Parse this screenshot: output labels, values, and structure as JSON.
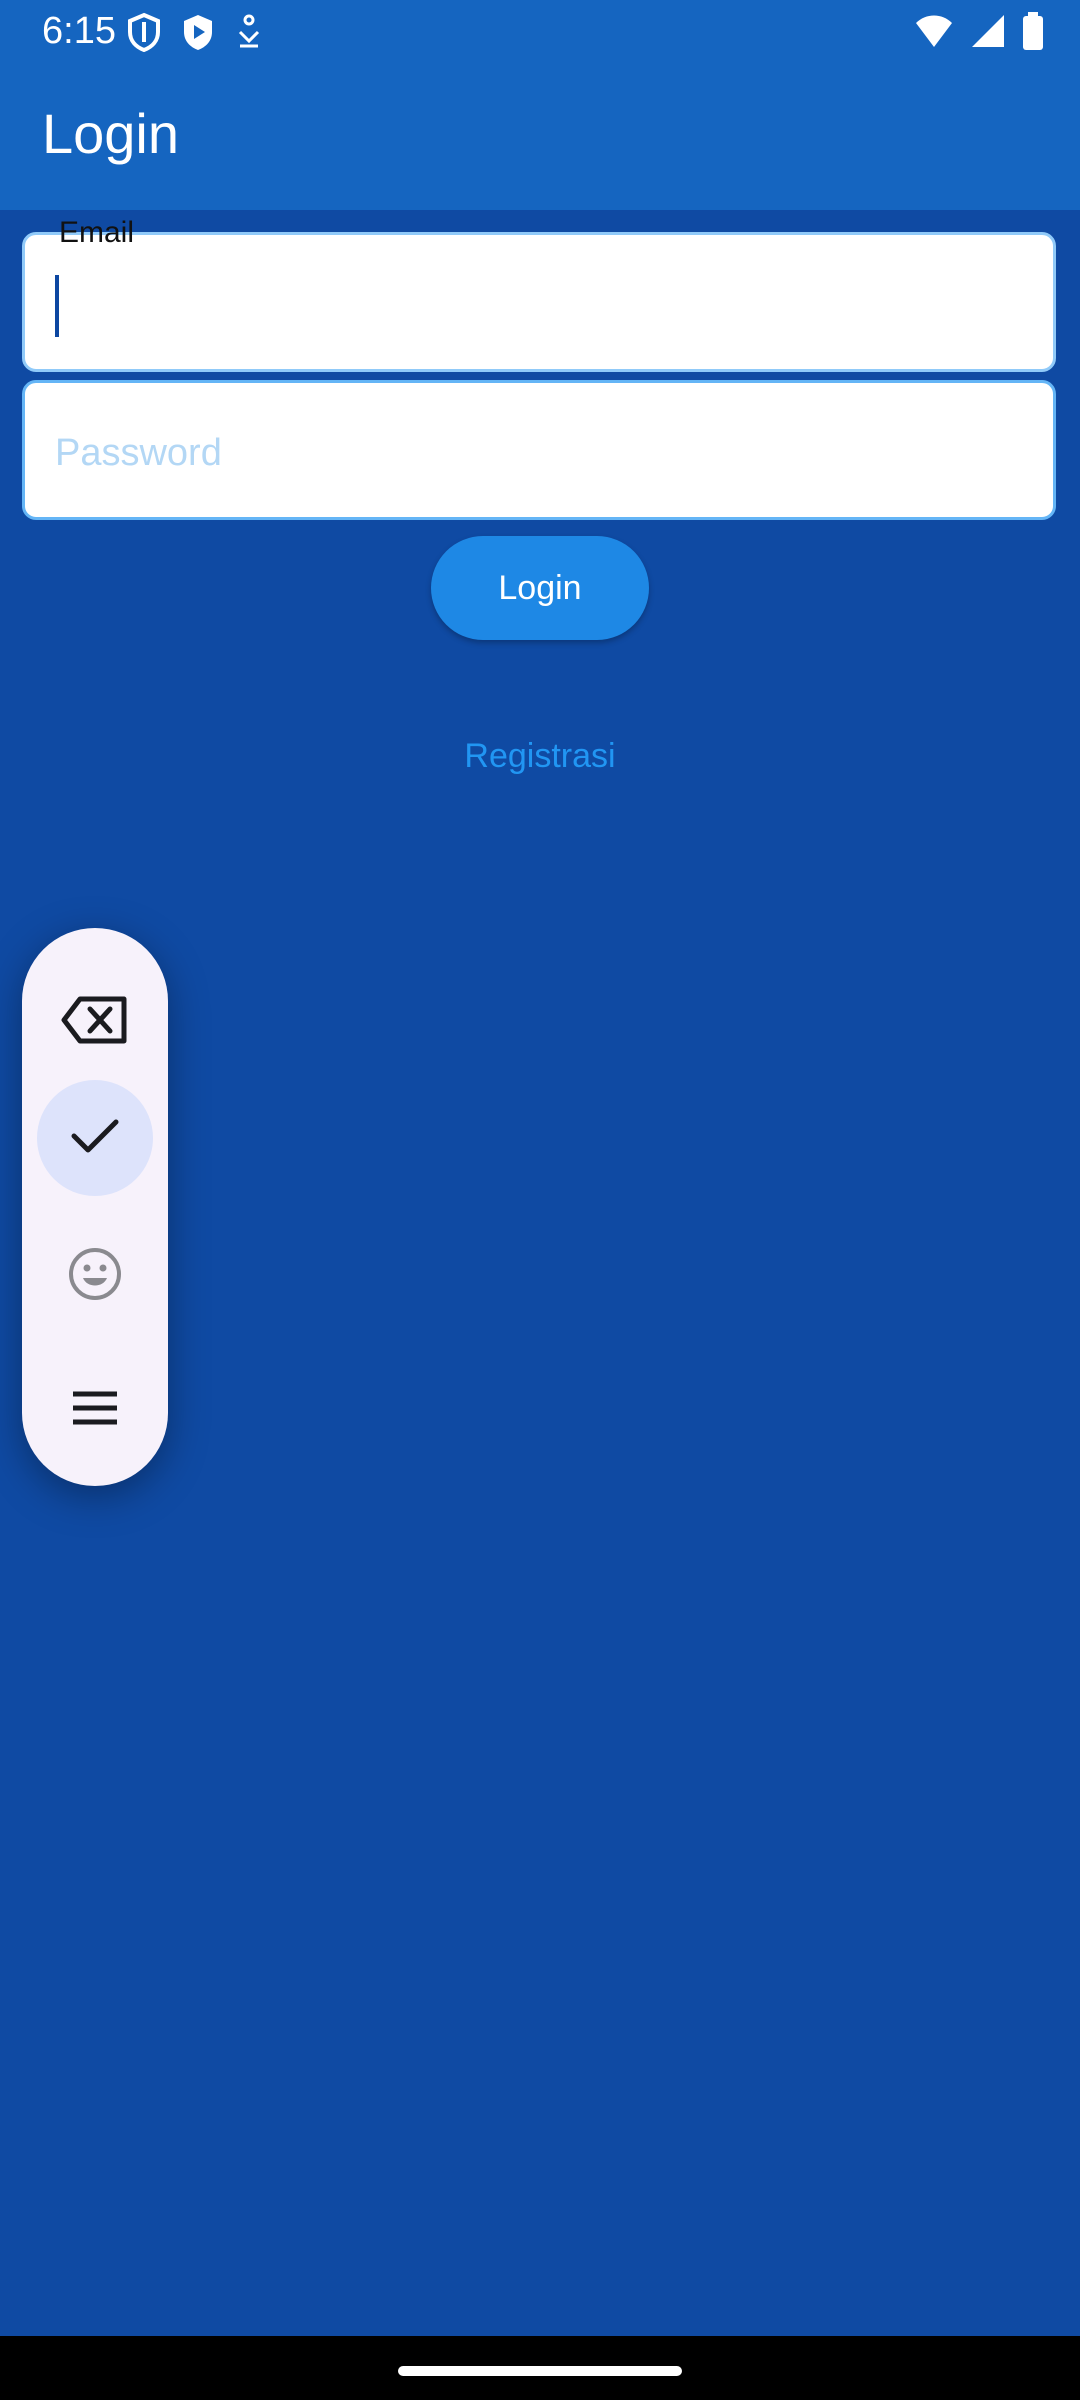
{
  "status_bar": {
    "time": "6:15",
    "left_icons": [
      "shield-icon",
      "play-shield-icon",
      "download-icon"
    ],
    "right_icons": [
      "wifi-icon",
      "signal-icon",
      "battery-icon"
    ]
  },
  "app_bar": {
    "title": "Login",
    "color": "#1565c0"
  },
  "form": {
    "email_label": "Email",
    "email_value": "",
    "password_placeholder": "Password",
    "login_button": "Login",
    "register_link": "Registrasi"
  },
  "toolbar": {
    "items": [
      "backspace-icon",
      "check-icon",
      "emoji-icon",
      "menu-icon"
    ],
    "selected": "check-icon"
  },
  "colors": {
    "background": "#0f4aa3",
    "accent": "#1e88e5",
    "link": "#2196f3"
  }
}
